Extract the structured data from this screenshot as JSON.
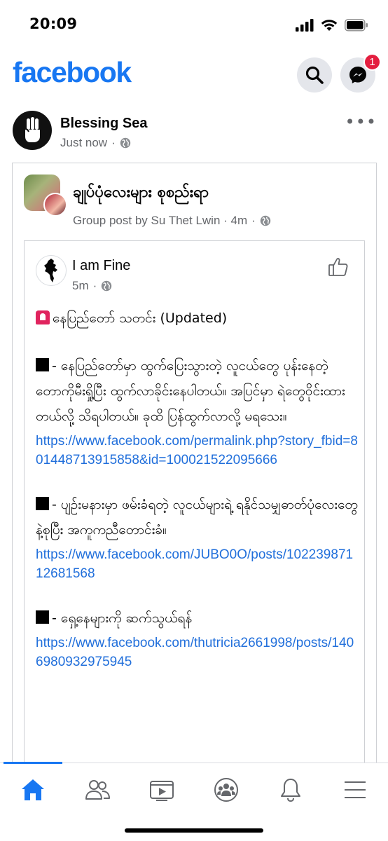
{
  "status_bar": {
    "time": "20:09",
    "icons": [
      "cellular-signal-icon",
      "wifi-icon",
      "battery-icon"
    ]
  },
  "header": {
    "logo": "facebook",
    "search_icon": "search-icon",
    "messenger_icon": "messenger-icon",
    "messenger_badge": "1",
    "brand_color": "#1877f2",
    "badge_color": "#e41e3f"
  },
  "post": {
    "author": "Blessing Sea",
    "time": "Just now",
    "more": "•••",
    "shared_group": {
      "name": "ချုပ်ပုံလေးများ စုစည်းရာ",
      "meta": "Group post by Su Thet Lwin · 4m",
      "inner_post": {
        "author": "I am Fine",
        "time": "5m",
        "title": "နေပြည်တော် သတင်း (Updated)",
        "items": [
          {
            "text": "- နေပြည်တော်မှာ ထွက်ပြေးသွားတဲ့ လူငယ်တွေ ပုန်းနေတဲ့ တောကိုမီးရှို့ပြီး ထွက်လာခိုင်းနေပါတယ်။ အပြင်မှာ ရဲတွေဝိုင်းထားတယ်လို့ သိရပါတယ်။ ခုထိ ပြန်ထွက်လာလို့ မရသေး။",
            "link": "https://www.facebook.com/permalink.php?story_fbid=801448713915858&id=100021522095666"
          },
          {
            "text": "- ပျဉ်းမနားမှာ ဖမ်းခံရတဲ့ လူငယ်များရဲ့ ရနိုင်သမျှဓာတ်ပုံလေးတွေနဲ့စုပြီး အကူကညီတောင်းခံ။",
            "link": "https://www.facebook.com/JUBO0O/posts/10223987112681568"
          },
          {
            "text": "- ရှေ့နေများကို ဆက်သွယ်ရန်",
            "link": "https://www.facebook.com/thutricia2661998/posts/1406980932975945"
          }
        ]
      }
    }
  },
  "bottom_nav": {
    "items": [
      "home-icon",
      "friends-icon",
      "watch-icon",
      "groups-icon",
      "notifications-icon",
      "menu-icon"
    ],
    "active": "home-icon",
    "active_color": "#1877f2"
  },
  "colors": {
    "link": "#216fdb",
    "secondary_text": "#65676b"
  }
}
